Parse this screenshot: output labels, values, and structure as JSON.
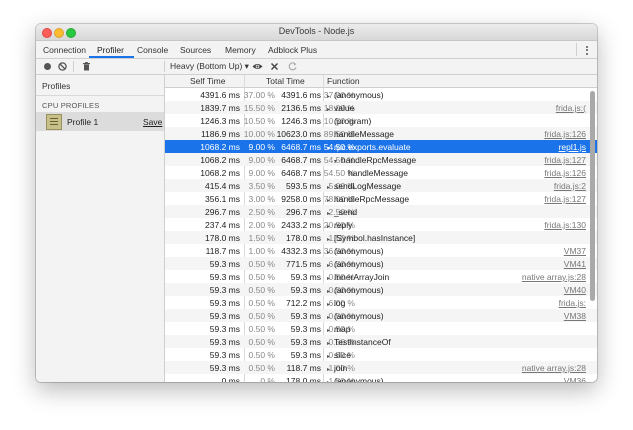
{
  "window": {
    "title": "DevTools - Node.js"
  },
  "tabs": [
    {
      "label": "Connection"
    },
    {
      "label": "Profiler"
    },
    {
      "label": "Console"
    },
    {
      "label": "Sources"
    },
    {
      "label": "Memory"
    },
    {
      "label": "Adblock Plus"
    }
  ],
  "toolbar": {
    "view_mode": "Heavy (Bottom Up) ▾"
  },
  "sidebar": {
    "heading": "Profiles",
    "section": "CPU PROFILES",
    "profile_label": "Profile 1",
    "save_label": "Save"
  },
  "grid": {
    "headers": {
      "self": "Self Time",
      "total": "Total Time",
      "function": "Function"
    },
    "rows": [
      {
        "self_ms": "4391.6 ms",
        "self_pct": "37.00 %",
        "total_ms": "4391.6 ms",
        "total_pct": "37.00 %",
        "arrow": "▸",
        "indent": 0,
        "name": "(anonymous)",
        "url": ""
      },
      {
        "self_ms": "1839.7 ms",
        "self_pct": "15.50 %",
        "total_ms": "2136.5 ms",
        "total_pct": "18.00 %",
        "arrow": "▸",
        "indent": 0,
        "name": "value",
        "url": "frida.js:("
      },
      {
        "self_ms": "1246.3 ms",
        "self_pct": "10.50 %",
        "total_ms": "1246.3 ms",
        "total_pct": "10.50 %",
        "arrow": "",
        "indent": 0,
        "name": "(program)",
        "url": ""
      },
      {
        "self_ms": "1186.9 ms",
        "self_pct": "10.00 %",
        "total_ms": "10623.0 ms",
        "total_pct": "89.50 %",
        "arrow": "",
        "indent": 0,
        "name": "handleMessage",
        "url": "frida.js:126"
      },
      {
        "self_ms": "1068.2 ms",
        "self_pct": "9.00 %",
        "total_ms": "6468.7 ms",
        "total_pct": "54.50 %",
        "arrow": "▾",
        "indent": 0,
        "name": "rpc.exports.evaluate",
        "url": "repl1.js",
        "selected": true
      },
      {
        "self_ms": "1068.2 ms",
        "self_pct": "9.00 %",
        "total_ms": "6468.7 ms",
        "total_pct": "54.50 %",
        "arrow": "▾",
        "indent": 1,
        "name": "handleRpcMessage",
        "url": "frida.js:127"
      },
      {
        "self_ms": "1068.2 ms",
        "self_pct": "9.00 %",
        "total_ms": "6468.7 ms",
        "total_pct": "54.50 %",
        "arrow": "",
        "indent": 2,
        "name": "handleMessage",
        "url": "frida.js:126"
      },
      {
        "self_ms": "415.4 ms",
        "self_pct": "3.50 %",
        "total_ms": "593.5 ms",
        "total_pct": "5.00 %",
        "arrow": "▸",
        "indent": 0,
        "name": "sendLogMessage",
        "url": "frida.js:2"
      },
      {
        "self_ms": "356.1 ms",
        "self_pct": "3.00 %",
        "total_ms": "9258.0 ms",
        "total_pct": "78.00 %",
        "arrow": "▸",
        "indent": 0,
        "name": "handleRpcMessage",
        "url": "frida.js:127"
      },
      {
        "self_ms": "296.7 ms",
        "self_pct": "2.50 %",
        "total_ms": "296.7 ms",
        "total_pct": "2.50 %",
        "arrow": "▸",
        "indent": 0,
        "name": "_send",
        "url": ""
      },
      {
        "self_ms": "237.4 ms",
        "self_pct": "2.00 %",
        "total_ms": "2433.2 ms",
        "total_pct": "20.50 %",
        "arrow": "▸",
        "indent": 0,
        "name": "reply",
        "url": "frida.js:130"
      },
      {
        "self_ms": "178.0 ms",
        "self_pct": "1.50 %",
        "total_ms": "178.0 ms",
        "total_pct": "1.50 %",
        "arrow": "▸",
        "indent": 0,
        "name": "[Symbol.hasInstance]",
        "url": ""
      },
      {
        "self_ms": "118.7 ms",
        "self_pct": "1.00 %",
        "total_ms": "4332.3 ms",
        "total_pct": "36.50 %",
        "arrow": "▸",
        "indent": 0,
        "name": "(anonymous)",
        "url": "VM37"
      },
      {
        "self_ms": "59.3 ms",
        "self_pct": "0.50 %",
        "total_ms": "771.5 ms",
        "total_pct": "6.50 %",
        "arrow": "▸",
        "indent": 0,
        "name": "(anonymous)",
        "url": "VM41"
      },
      {
        "self_ms": "59.3 ms",
        "self_pct": "0.50 %",
        "total_ms": "59.3 ms",
        "total_pct": "0.50 %",
        "arrow": "▸",
        "indent": 0,
        "name": "InnerArrayJoin",
        "url": "native array.js:28"
      },
      {
        "self_ms": "59.3 ms",
        "self_pct": "0.50 %",
        "total_ms": "59.3 ms",
        "total_pct": "0.50 %",
        "arrow": "▸",
        "indent": 0,
        "name": "(anonymous)",
        "url": "VM40"
      },
      {
        "self_ms": "59.3 ms",
        "self_pct": "0.50 %",
        "total_ms": "712.2 ms",
        "total_pct": "6.00 %",
        "arrow": "▸",
        "indent": 0,
        "name": "log",
        "url": "frida.js:"
      },
      {
        "self_ms": "59.3 ms",
        "self_pct": "0.50 %",
        "total_ms": "59.3 ms",
        "total_pct": "0.50 %",
        "arrow": "▸",
        "indent": 0,
        "name": "(anonymous)",
        "url": "VM38"
      },
      {
        "self_ms": "59.3 ms",
        "self_pct": "0.50 %",
        "total_ms": "59.3 ms",
        "total_pct": "0.50 %",
        "arrow": "▸",
        "indent": 0,
        "name": "map",
        "url": ""
      },
      {
        "self_ms": "59.3 ms",
        "self_pct": "0.50 %",
        "total_ms": "59.3 ms",
        "total_pct": "0.50 %",
        "arrow": "▸",
        "indent": 0,
        "name": "TestInstanceOf",
        "url": ""
      },
      {
        "self_ms": "59.3 ms",
        "self_pct": "0.50 %",
        "total_ms": "59.3 ms",
        "total_pct": "0.50 %",
        "arrow": "▸",
        "indent": 0,
        "name": "slice",
        "url": ""
      },
      {
        "self_ms": "59.3 ms",
        "self_pct": "0.50 %",
        "total_ms": "118.7 ms",
        "total_pct": "1.00 %",
        "arrow": "▸",
        "indent": 0,
        "name": "join",
        "url": "native array.js:28"
      },
      {
        "self_ms": "0 ms",
        "self_pct": "0 %",
        "total_ms": "178.0 ms",
        "total_pct": "1.50 %",
        "arrow": "▸",
        "indent": 0,
        "name": "(anonymous)",
        "url": "VM36"
      }
    ]
  },
  "colors": {
    "selection": "#1a73e8",
    "tab_underline": "#1a73e8"
  }
}
